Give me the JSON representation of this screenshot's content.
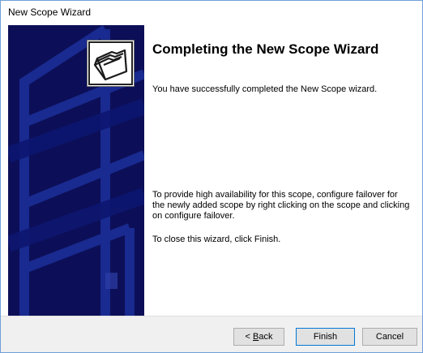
{
  "window": {
    "title": "New Scope Wizard"
  },
  "side_panel": {
    "background_color": "#0c0f57",
    "icon": "folders-icon"
  },
  "content": {
    "heading": "Completing the New Scope Wizard",
    "intro": "You have successfully completed the New Scope wizard.",
    "failover_note": "To provide high availability for this scope, configure failover for the newly added scope by right clicking on the scope and clicking on configure failover.",
    "close_note": "To close this wizard, click Finish."
  },
  "buttons": {
    "back_prefix": "< ",
    "back_accel": "B",
    "back_rest": "ack",
    "finish": "Finish",
    "cancel": "Cancel"
  }
}
